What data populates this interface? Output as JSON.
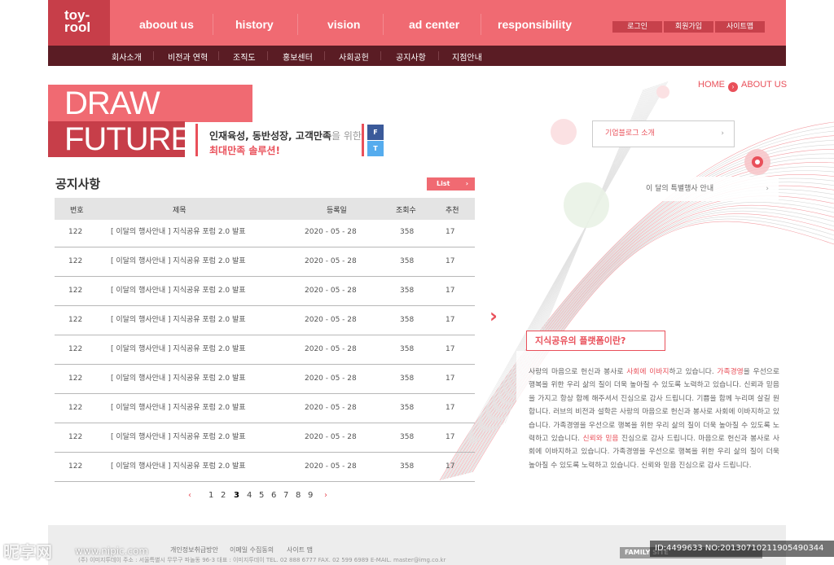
{
  "logo": {
    "line1": "toy-",
    "line2": "rool"
  },
  "main_nav": [
    "aboout us",
    "history",
    "vision",
    "ad center",
    "responsibility"
  ],
  "util_nav": [
    "로그인",
    "회원가입",
    "사이트맵"
  ],
  "sub_nav": [
    "회사소개",
    "비전과 연혁",
    "조직도",
    "홍보센터",
    "사회공헌",
    "공지사항",
    "지점안내"
  ],
  "breadcrumb": {
    "home": "HOME",
    "current": "ABOUT US"
  },
  "hero": {
    "line1": "DRAW YOUR",
    "line2": "FUTURE",
    "tagline_bold": "인재육성, 동반성장, 고객만족",
    "tagline_light": "을 위한",
    "tagline_accent": "최대만족 솔루션!"
  },
  "social": {
    "facebook": "F",
    "twitter": "T"
  },
  "notice": {
    "title": "공지사항",
    "list_button": "List",
    "columns": [
      "번호",
      "제목",
      "등록일",
      "조회수",
      "추천"
    ],
    "rows": [
      {
        "no": "122",
        "title": "[ 이달의 행사안내 ] 지식공유 포럼 2.0 발표",
        "date": "2020 - 05 - 28",
        "views": "358",
        "rec": "17"
      },
      {
        "no": "122",
        "title": "[ 이달의 행사안내 ] 지식공유 포럼 2.0 발표",
        "date": "2020 - 05 - 28",
        "views": "358",
        "rec": "17"
      },
      {
        "no": "122",
        "title": "[ 이달의 행사안내 ] 지식공유 포럼 2.0 발표",
        "date": "2020 - 05 - 28",
        "views": "358",
        "rec": "17"
      },
      {
        "no": "122",
        "title": "[ 이달의 행사안내 ] 지식공유 포럼 2.0 발표",
        "date": "2020 - 05 - 28",
        "views": "358",
        "rec": "17"
      },
      {
        "no": "122",
        "title": "[ 이달의 행사안내 ] 지식공유 포럼 2.0 발표",
        "date": "2020 - 05 - 28",
        "views": "358",
        "rec": "17"
      },
      {
        "no": "122",
        "title": "[ 이달의 행사안내 ] 지식공유 포럼 2.0 발표",
        "date": "2020 - 05 - 28",
        "views": "358",
        "rec": "17"
      },
      {
        "no": "122",
        "title": "[ 이달의 행사안내 ] 지식공유 포럼 2.0 발표",
        "date": "2020 - 05 - 28",
        "views": "358",
        "rec": "17"
      },
      {
        "no": "122",
        "title": "[ 이달의 행사안내 ] 지식공유 포럼 2.0 발표",
        "date": "2020 - 05 - 28",
        "views": "358",
        "rec": "17"
      },
      {
        "no": "122",
        "title": "[ 이달의 행사안내 ] 지식공유 포럼 2.0 발표",
        "date": "2020 - 05 - 28",
        "views": "358",
        "rec": "17"
      }
    ]
  },
  "pagination": {
    "prev": "‹",
    "next": "›",
    "pages": [
      "1",
      "2",
      "3",
      "4",
      "5",
      "6",
      "7",
      "8",
      "9"
    ],
    "current": "3"
  },
  "side": {
    "box1": "기업블로그 소개",
    "box2": "이 달의 특별행사 안내",
    "knowledge_title": "지식공유의 플랫폼이란?",
    "knowledge_parts": [
      {
        "text": "사랑의 마음으로 헌신과 봉사로 ",
        "hl": false
      },
      {
        "text": "사회에 이바지",
        "hl": true
      },
      {
        "text": "하고 있습니다. ",
        "hl": false
      },
      {
        "text": "가족경영",
        "hl": true
      },
      {
        "text": "을 우선으로 행복을 위한 우리 삶의 질이 더욱 높아질 수 있도록 노력하고 있습니다. 신뢰과 믿음을 가지고 항상 함께 해주셔서 진심으로 감사 드립니다. 기쁨을 함께 누리며 살길 원합니다. 러브의 비전과 설학은 사랑의 마음으로 헌신과 봉사로 사회에 이바지하고 있습니다. 가족경영을 우선으로 행복을 위한 우리 삶의 질이 더욱 높아질 수 있도록 노력하고 있습니다. ",
        "hl": false
      },
      {
        "text": "신뢰와 믿음",
        "hl": true
      },
      {
        "text": " 진심으로 감사 드립니다. 마음으로 헌신과 봉사로 사회에 이바지하고 있습니다. 가족경영을 우선으로 행복을 위한 우리 삶의 질이 더욱 높아질 수 있도록 노력하고 있습니다. 신뢰와 믿음 진심으로 감사 드립니다.",
        "hl": false
      }
    ]
  },
  "footer": {
    "links": [
      "개인정보취급방안",
      "이메일 수집동의",
      "사이트 맵"
    ],
    "copyright": "(주) 이미지투데이  주소 : 서울특별시 무무구 파놀동 96-3  대표 : 이미지투데이  TEL. 02 888 6777  FAX. 02 599 6989  E-MAIL. master@img.co.kr",
    "family_site": "FAMILY SITE"
  },
  "watermark": {
    "left": "昵享网",
    "url": "www.nipic.com",
    "id": "ID:4499633 NO:20130710211905490344"
  },
  "colors": {
    "primary": "#f06a72",
    "dark": "#c73e49",
    "subnav": "#5a1c24",
    "accent": "#e9505a"
  }
}
